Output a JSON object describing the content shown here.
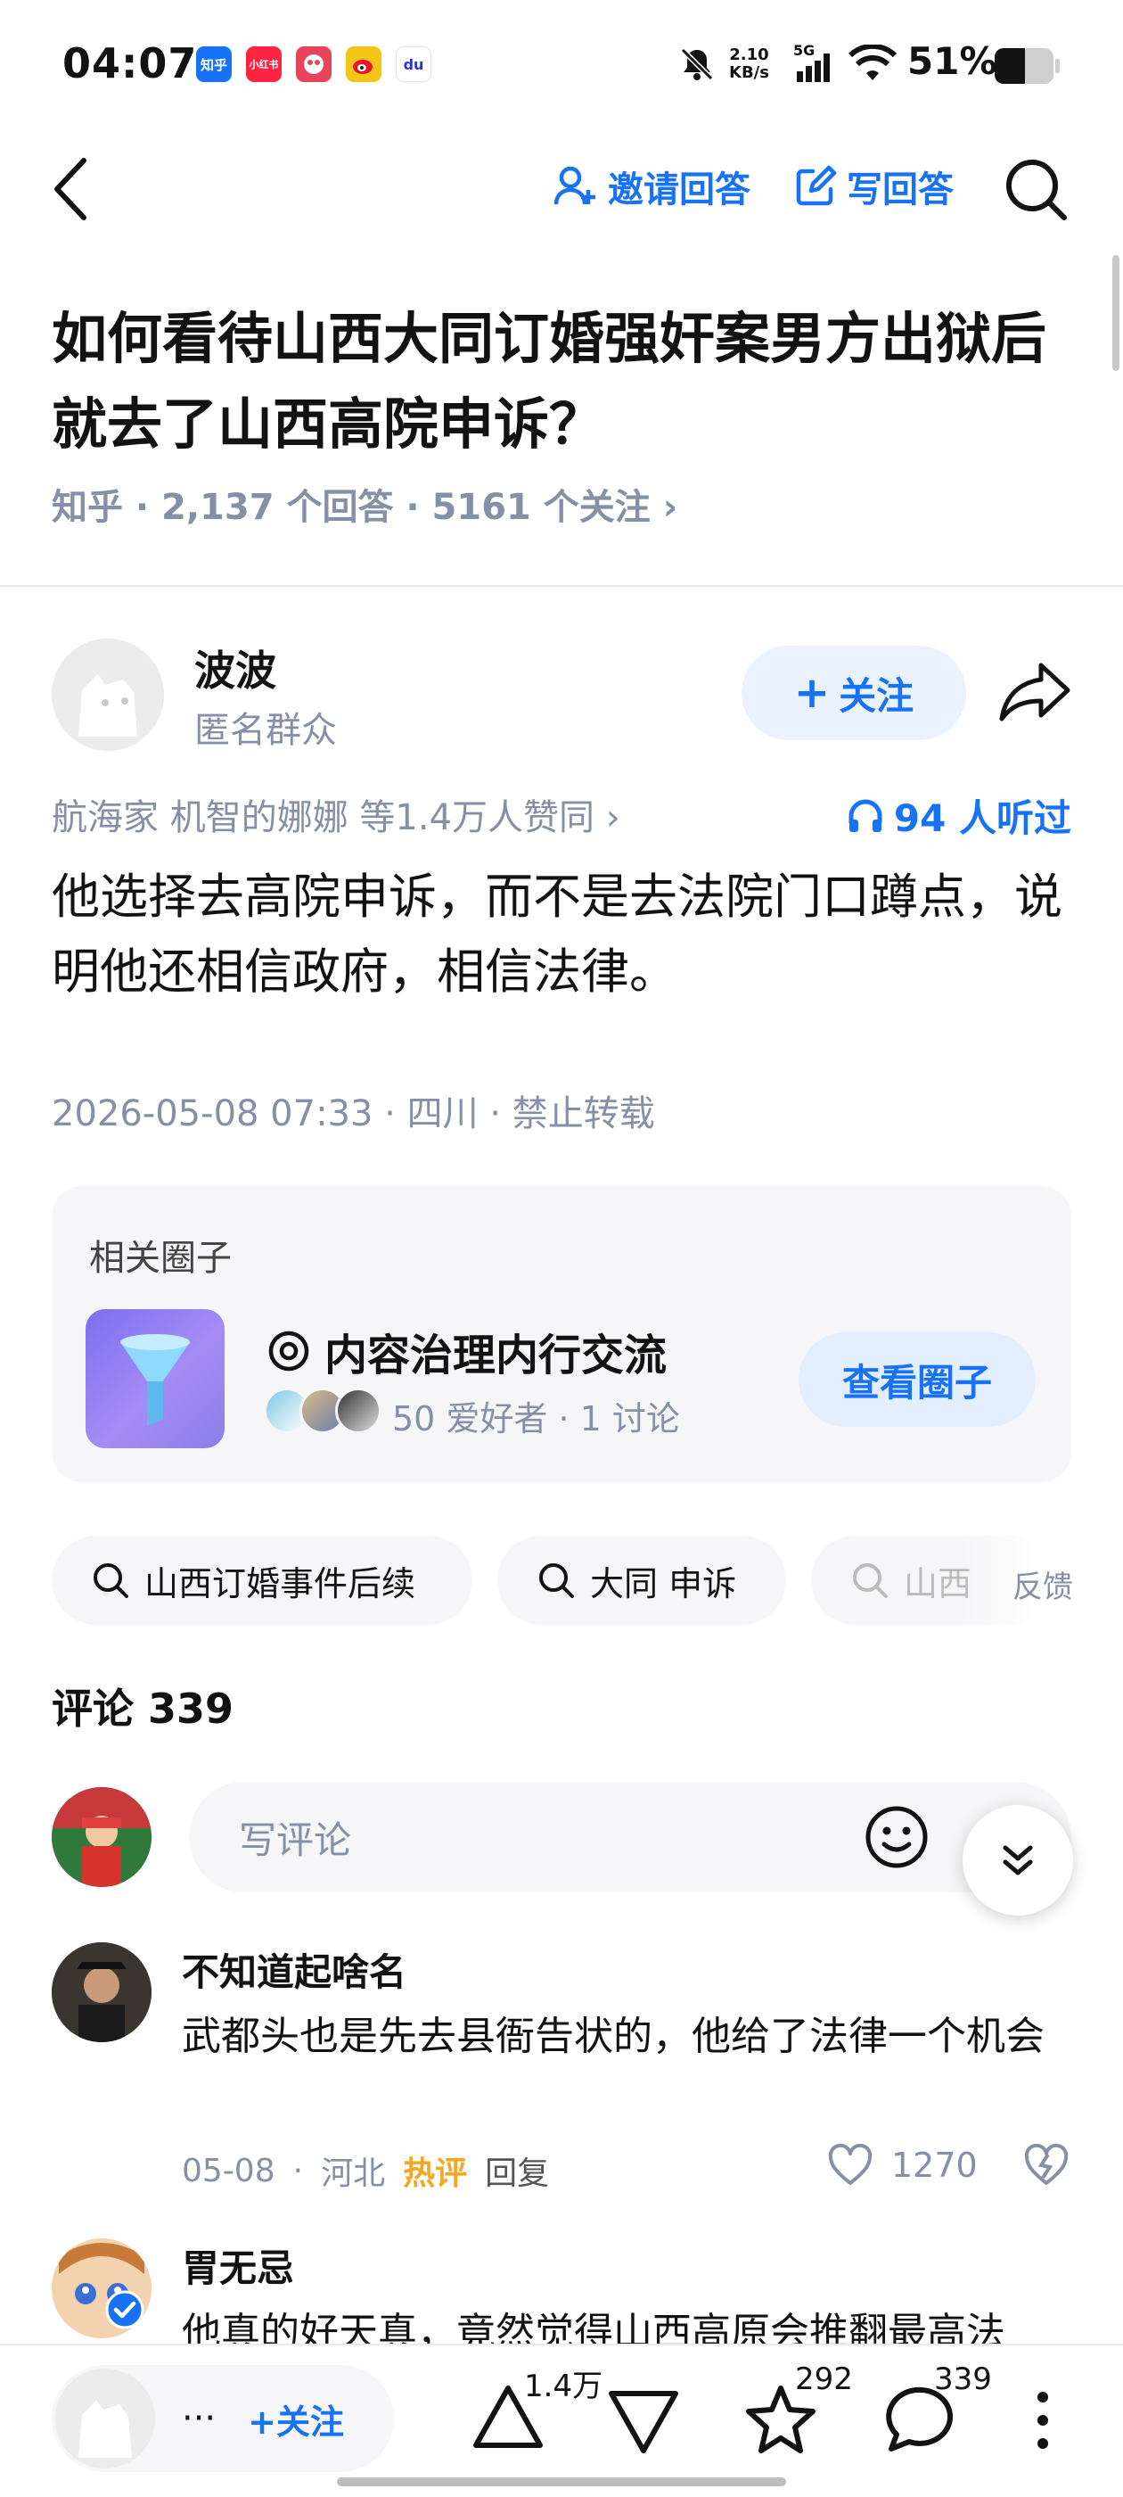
{
  "status_bar": {
    "time": "04:07",
    "apps": [
      {
        "name": "zhihu-app-icon",
        "label": "知乎",
        "color": "#1772f6"
      },
      {
        "name": "xiaohongshu-app-icon",
        "label": "小红书",
        "color": "#ff2442"
      },
      {
        "name": "game-app-icon",
        "label": "",
        "color": "#e8435b"
      },
      {
        "name": "weibo-app-icon",
        "label": "",
        "color": "#f5c518"
      },
      {
        "name": "baidu-app-icon",
        "label": "du",
        "color": "#ffffff"
      }
    ],
    "net_speed_value": "2.10",
    "net_speed_unit": "KB/s",
    "network": "5G",
    "battery": "51%"
  },
  "header": {
    "invite_label": "邀请回答",
    "write_label": "写回答"
  },
  "question": {
    "title": "如何看待山西大同订婚强奸案男方出狱后就去了山西高院申诉？",
    "meta": "知乎 · 2,137 个回答 · 5161 个关注 ›"
  },
  "author": {
    "name": "波波",
    "subtitle": "匿名群众",
    "follow_label": "关注"
  },
  "votes": {
    "text": "航海家 机智的娜娜 等1.4万人赞同 ›",
    "listen": "94 人听过"
  },
  "answer": {
    "text": "他选择去高院申诉，而不是去法院门口蹲点，说明他还相信政府，相信法律。",
    "meta": "2026-05-08 07:33 · 四川 · 禁止转载"
  },
  "circle": {
    "section_label": "相关圈子",
    "name": "内容治理内行交流",
    "stats": "50 爱好者 · 1 讨论",
    "button_label": "查看圈子"
  },
  "search_chips": [
    "山西订婚事件后续",
    "大同 申诉",
    "山西"
  ],
  "feedback_label": "反馈",
  "comments": {
    "header": "评论 339",
    "input_placeholder": "写评论",
    "items": [
      {
        "name": "不知道起啥名",
        "text": "武都头也是先去县衙告状的，他给了法律一个机会",
        "date": "05-08",
        "location": "河北",
        "tag": "热评",
        "reply_label": "回复",
        "likes": "1270"
      },
      {
        "name": "胃无忌",
        "text": "他真的好天真，竟然觉得山西高原会推翻最高法"
      }
    ]
  },
  "bottom_bar": {
    "more_dots": "···",
    "follow_label": "关注",
    "upvotes": "1.4万",
    "favorites": "292",
    "comments": "339"
  }
}
